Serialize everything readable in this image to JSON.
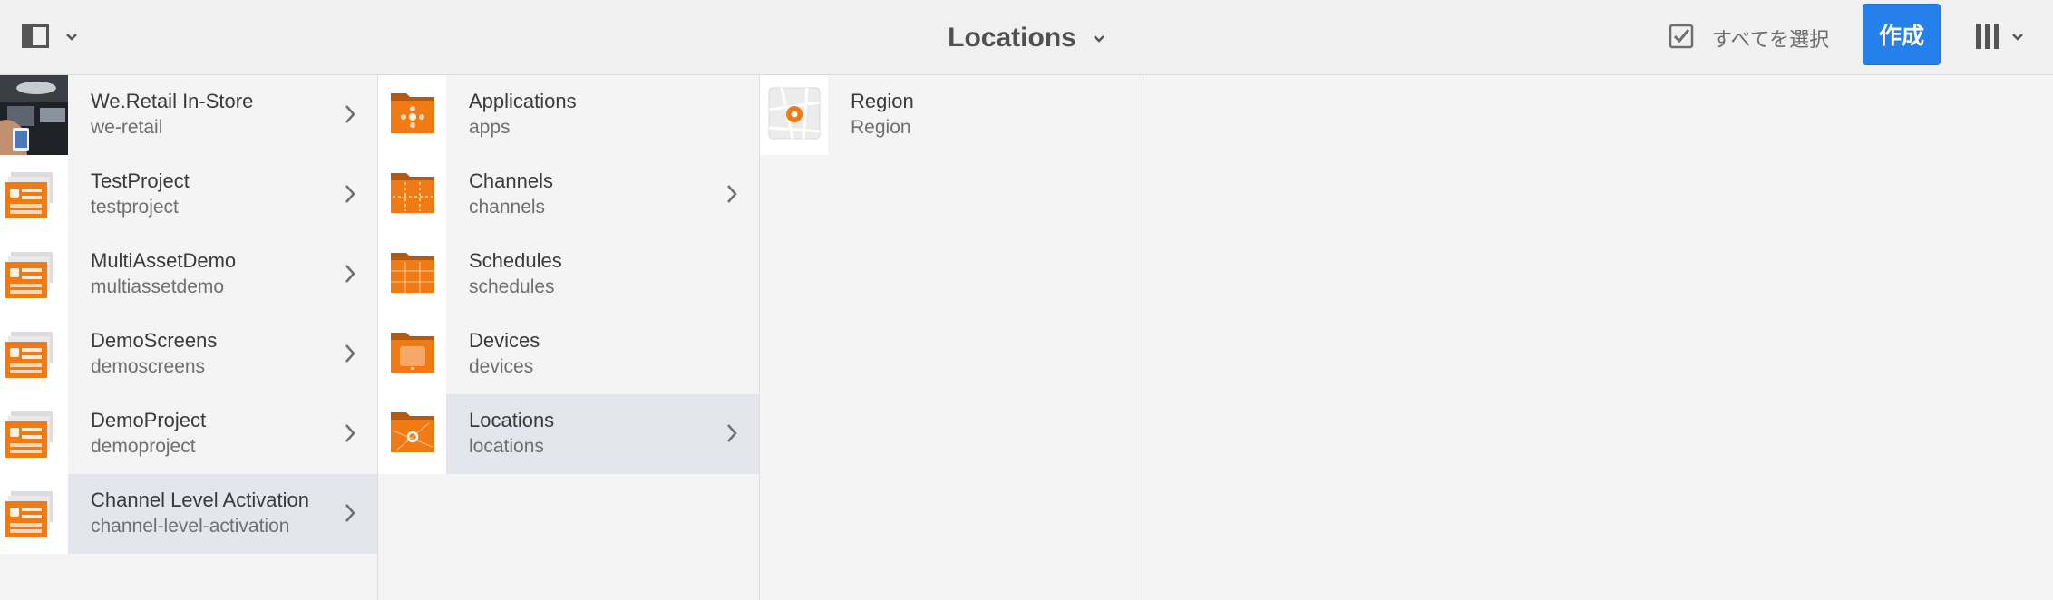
{
  "header": {
    "title": "Locations",
    "select_all_label": "すべてを選択",
    "create_label": "作成"
  },
  "columns": [
    {
      "items": [
        {
          "title": "We.Retail In-Store",
          "subtitle": "we-retail",
          "thumbnail": "photo-thumbnail",
          "has_children": true,
          "selected": false
        },
        {
          "title": "TestProject",
          "subtitle": "testproject",
          "thumbnail": "project-icon",
          "has_children": true,
          "selected": false
        },
        {
          "title": "MultiAssetDemo",
          "subtitle": "multiassetdemo",
          "thumbnail": "project-icon",
          "has_children": true,
          "selected": false
        },
        {
          "title": "DemoScreens",
          "subtitle": "demoscreens",
          "thumbnail": "project-icon",
          "has_children": true,
          "selected": false
        },
        {
          "title": "DemoProject",
          "subtitle": "demoproject",
          "thumbnail": "project-icon",
          "has_children": true,
          "selected": false
        },
        {
          "title": "Channel Level Activation",
          "subtitle": "channel-level-activation",
          "thumbnail": "project-icon",
          "has_children": true,
          "selected": true
        }
      ]
    },
    {
      "items": [
        {
          "title": "Applications",
          "subtitle": "apps",
          "thumbnail": "applications-folder-icon",
          "has_children": false,
          "selected": false
        },
        {
          "title": "Channels",
          "subtitle": "channels",
          "thumbnail": "channels-folder-icon",
          "has_children": true,
          "selected": false
        },
        {
          "title": "Schedules",
          "subtitle": "schedules",
          "thumbnail": "schedules-folder-icon",
          "has_children": false,
          "selected": false
        },
        {
          "title": "Devices",
          "subtitle": "devices",
          "thumbnail": "devices-folder-icon",
          "has_children": false,
          "selected": false
        },
        {
          "title": "Locations",
          "subtitle": "locations",
          "thumbnail": "locations-folder-icon",
          "has_children": true,
          "selected": true
        }
      ]
    },
    {
      "items": [
        {
          "title": "Region",
          "subtitle": "Region",
          "thumbnail": "map-pin-icon",
          "has_children": false,
          "selected": false
        }
      ]
    }
  ],
  "colors": {
    "accent": "#2680eb",
    "orange": "#f07a14",
    "selected_row": "#e3e7ed"
  }
}
